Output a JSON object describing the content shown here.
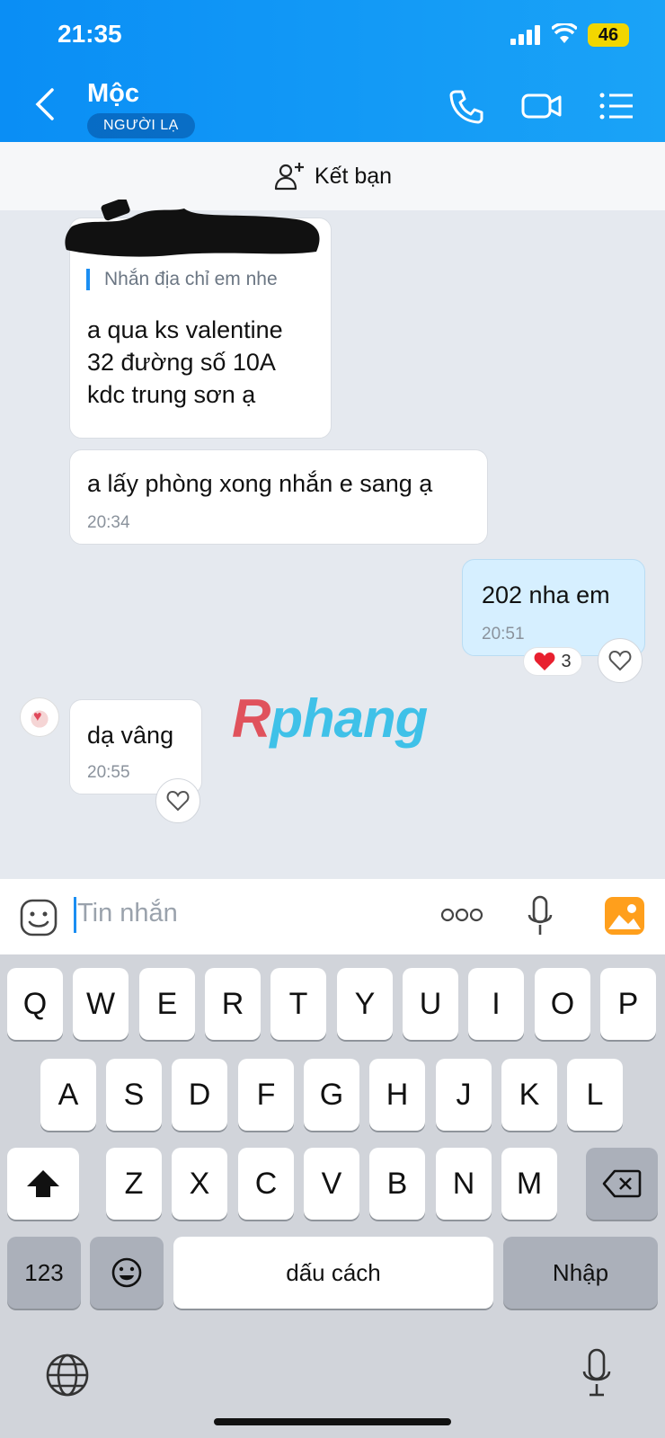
{
  "status": {
    "time": "21:35",
    "battery": "46"
  },
  "header": {
    "name": "Mộc",
    "badge": "NGƯỜI LẠ"
  },
  "add_friend": {
    "label": "Kết bạn"
  },
  "messages": [
    {
      "quote": "Nhắn địa chỉ em nhe",
      "lines": [
        "a qua ks valentine",
        "32 đường số 10A",
        "kdc trung sơn ạ"
      ]
    },
    {
      "text": "a lấy phòng xong nhắn e sang ạ",
      "time": "20:34"
    },
    {
      "text": "202 nha em",
      "time": "20:51",
      "reaction_count": "3"
    },
    {
      "text": "dạ vâng",
      "time": "20:55"
    }
  ],
  "watermark": {
    "first": "R",
    "rest": "phang"
  },
  "input": {
    "placeholder": "Tin nhắn"
  },
  "keyboard": {
    "row1": [
      "Q",
      "W",
      "E",
      "R",
      "T",
      "Y",
      "U",
      "I",
      "O",
      "P"
    ],
    "row2": [
      "A",
      "S",
      "D",
      "F",
      "G",
      "H",
      "J",
      "K",
      "L"
    ],
    "row3": [
      "Z",
      "X",
      "C",
      "V",
      "B",
      "N",
      "M"
    ],
    "num_label": "123",
    "space_label": "dấu cách",
    "enter_label": "Nhập"
  },
  "colors": {
    "accent": "#1b8ef2",
    "header_start": "#0a8ef5",
    "mine_bubble": "#d6efff"
  }
}
